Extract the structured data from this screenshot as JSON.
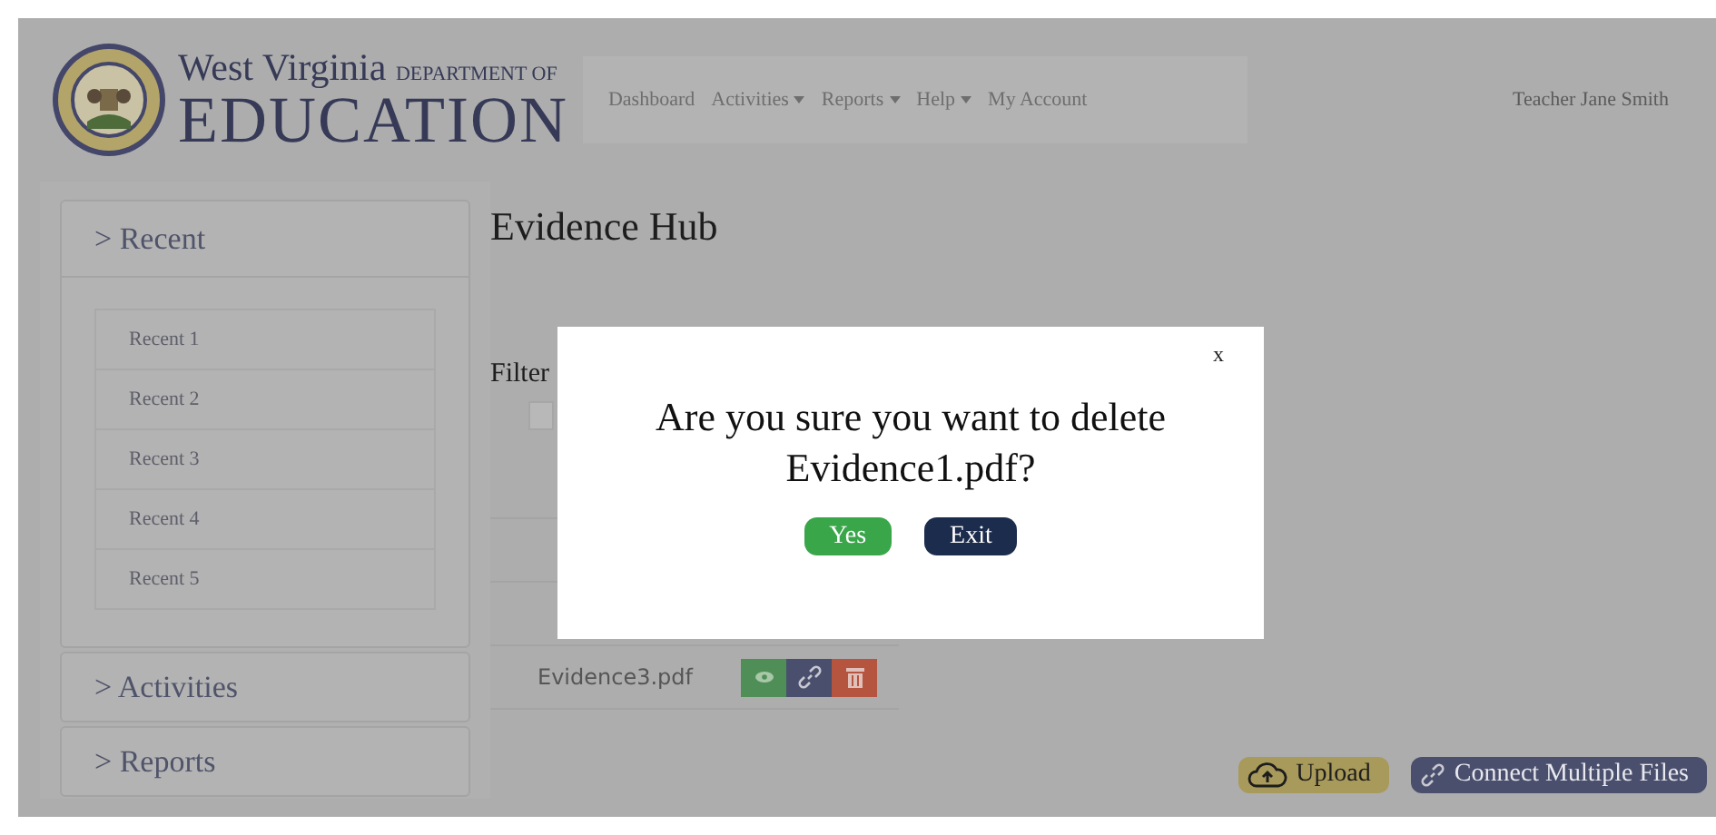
{
  "header": {
    "logo": {
      "line1": "West Virginia",
      "line1_small": "DEPARTMENT OF",
      "line2": "EDUCATION"
    },
    "nav": [
      {
        "label": "Dashboard",
        "dropdown": false
      },
      {
        "label": "Activities",
        "dropdown": true
      },
      {
        "label": "Reports",
        "dropdown": true
      },
      {
        "label": "Help",
        "dropdown": true
      },
      {
        "label": "My Account",
        "dropdown": false
      }
    ],
    "user": "Teacher Jane Smith"
  },
  "sidebar": {
    "sections": [
      {
        "label": "> Recent",
        "expanded": true,
        "items": [
          "Recent 1",
          "Recent 2",
          "Recent 3",
          "Recent 4",
          "Recent 5"
        ]
      },
      {
        "label": "> Activities",
        "expanded": false
      },
      {
        "label": "> Reports",
        "expanded": false
      }
    ]
  },
  "content": {
    "title": "Evidence Hub",
    "filter_label": "Filter",
    "files": [
      {
        "name": "Evidence3.pdf"
      }
    ],
    "buttons": [
      {
        "label": "Upload",
        "kind": "upload"
      },
      {
        "label": "Connect Multiple Files",
        "kind": "connect"
      }
    ]
  },
  "dialog": {
    "close": "x",
    "message": "Are you sure you want to delete Evidence1.pdf?",
    "buttons": [
      {
        "label": "Yes",
        "kind": "confirm"
      },
      {
        "label": "Exit",
        "kind": "cancel"
      }
    ]
  }
}
